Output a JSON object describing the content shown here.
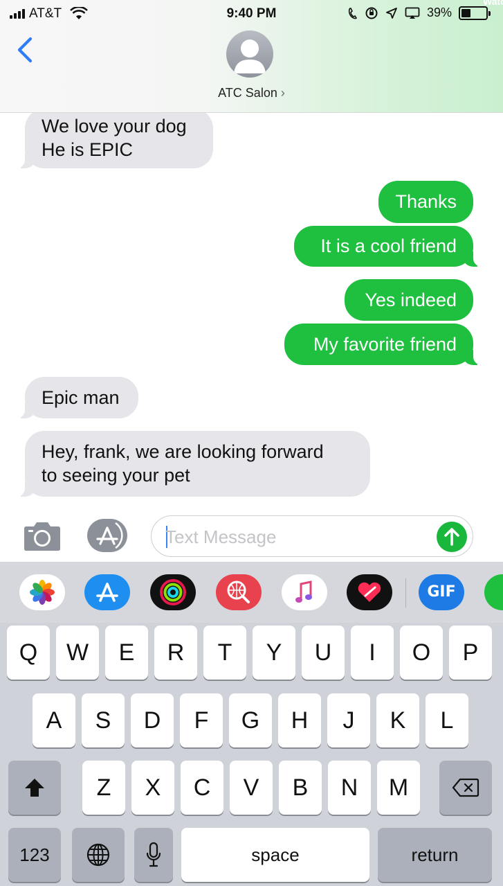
{
  "status_bar": {
    "carrier": "AT&T",
    "time": "9:40 PM",
    "battery_percent": "39%",
    "battery_level": 0.39,
    "corner_text": "Watc"
  },
  "header": {
    "back_icon": "chevron-left-icon",
    "avatar_icon": "person-silhouette-icon",
    "contact_name": "ATC Salon",
    "contact_chevron": "›"
  },
  "messages": [
    {
      "direction": "incoming",
      "lines": [
        "We love your dog",
        "He is EPIC"
      ]
    },
    {
      "direction": "outgoing",
      "lines": [
        "Thanks"
      ]
    },
    {
      "direction": "outgoing",
      "lines": [
        "It is a cool friend"
      ]
    },
    {
      "direction": "outgoing",
      "lines": [
        "Yes indeed"
      ]
    },
    {
      "direction": "outgoing",
      "lines": [
        "My favorite friend"
      ]
    },
    {
      "direction": "incoming",
      "lines": [
        "Epic man"
      ]
    },
    {
      "direction": "incoming",
      "lines": [
        "Hey, frank, we are looking forward",
        "to seeing your pet"
      ]
    }
  ],
  "composer": {
    "placeholder": "Text Message",
    "camera_icon": "camera-icon",
    "apps_icon": "app-store-icon",
    "send_icon": "arrow-up-icon"
  },
  "app_drawer": [
    {
      "name": "photos-app-icon",
      "color": "#ffffff"
    },
    {
      "name": "app-store-app-icon",
      "color": "#1e8ef0"
    },
    {
      "name": "activity-app-icon",
      "color": "#111111"
    },
    {
      "name": "search-images-app-icon",
      "color": "#e8424e"
    },
    {
      "name": "music-app-icon",
      "color": "#ffffff"
    },
    {
      "name": "digital-touch-app-icon",
      "color": "#111111"
    },
    {
      "name": "gif-app-icon",
      "color": "#1e7be6",
      "label": "GIF"
    }
  ],
  "keyboard": {
    "row1": [
      "Q",
      "W",
      "E",
      "R",
      "T",
      "Y",
      "U",
      "I",
      "O",
      "P"
    ],
    "row2": [
      "A",
      "S",
      "D",
      "F",
      "G",
      "H",
      "J",
      "K",
      "L"
    ],
    "row3": [
      "Z",
      "X",
      "C",
      "V",
      "B",
      "N",
      "M"
    ],
    "numbers_label": "123",
    "space_label": "space",
    "return_label": "return",
    "shift_icon": "shift-icon",
    "delete_icon": "backspace-icon",
    "globe_icon": "globe-icon",
    "mic_icon": "microphone-icon"
  },
  "colors": {
    "outgoing_bubble": "#1fbf3f",
    "incoming_bubble": "#e6e6ea",
    "ios_blue": "#3a82f7",
    "send_button": "#19b83d"
  }
}
